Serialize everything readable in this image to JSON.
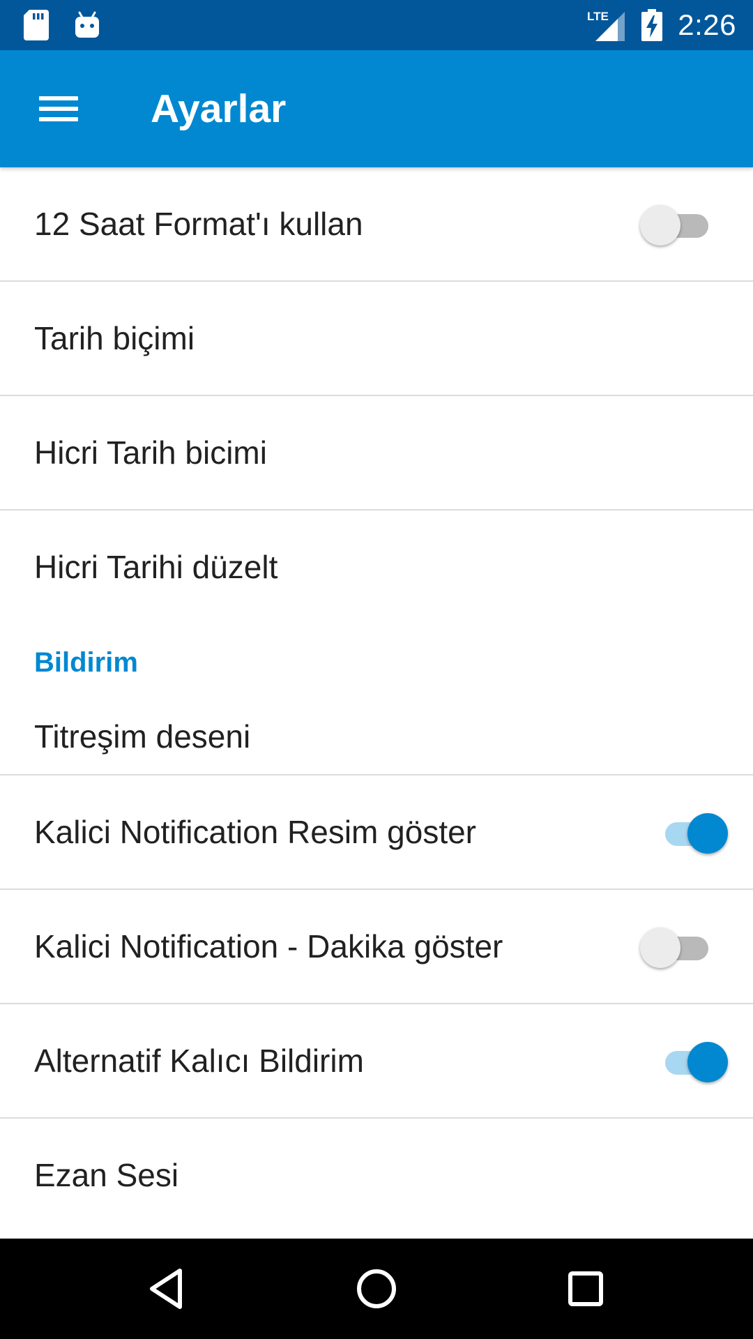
{
  "status_bar": {
    "time": "2:26",
    "network_label": "LTE",
    "icons": [
      "sd-card-icon",
      "android-icon",
      "lte-signal-icon",
      "battery-charging-icon"
    ]
  },
  "app_bar": {
    "title": "Ayarlar",
    "menu_icon": "hamburger-menu-icon"
  },
  "settings": {
    "use_12h_format": {
      "label": "12 Saat Format'ı kullan",
      "enabled": false
    },
    "date_format": {
      "label": "Tarih biçimi"
    },
    "hijri_date_format": {
      "label": "Hicri Tarih bicimi"
    },
    "hijri_date_adjust": {
      "label": "Hicri Tarihi düzelt"
    },
    "notification_section": {
      "header": "Bildirim"
    },
    "vibration_pattern": {
      "label": "Titreşim deseni"
    },
    "persistent_notification_image": {
      "label": "Kalici Notification Resim göster",
      "enabled": true
    },
    "persistent_notification_minutes": {
      "label": "Kalici Notification - Dakika göster",
      "enabled": false
    },
    "alternative_persistent_notification": {
      "label": "Alternatif Kalıcı Bildirim",
      "enabled": true
    },
    "adhan_sound": {
      "label": "Ezan Sesi"
    }
  },
  "nav_bar": {
    "icons": [
      "back-icon",
      "home-icon",
      "recents-icon"
    ]
  },
  "colors": {
    "status_bar": "#02579b",
    "app_bar": "#0288d1",
    "accent": "#0288d1",
    "switch_on_track": "#a8d7f1",
    "switch_off_track": "#b9b9b9",
    "switch_off_thumb": "#ececec",
    "divider": "#dcdcdc",
    "text_primary": "#212121"
  }
}
